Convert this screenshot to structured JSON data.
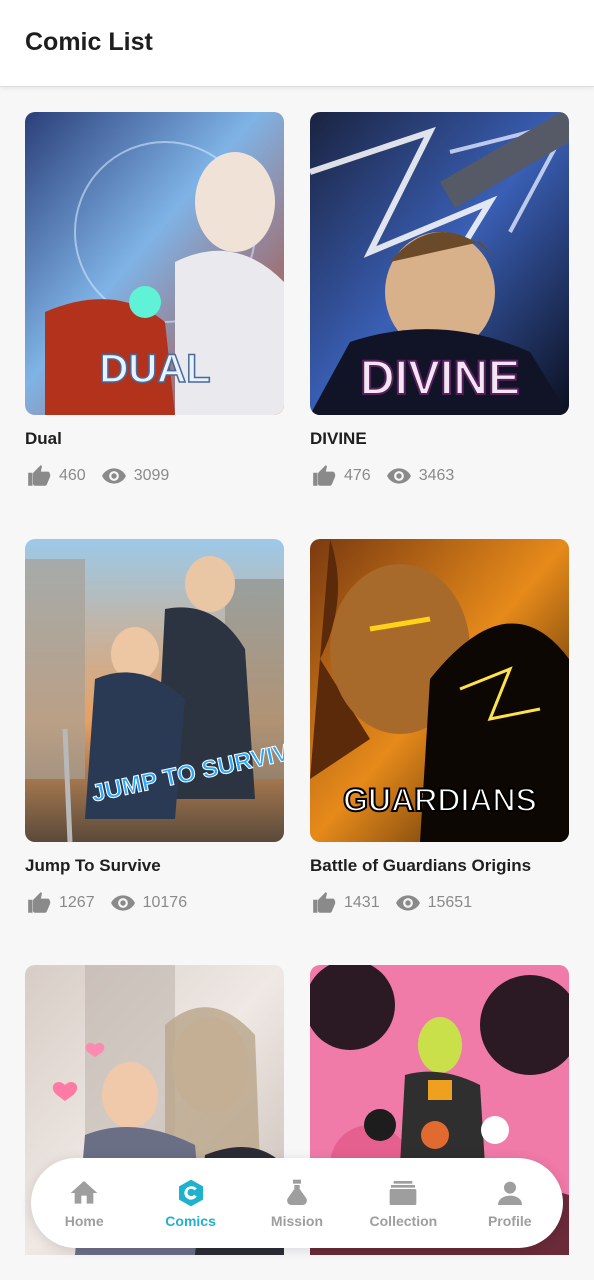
{
  "header": {
    "title": "Comic List"
  },
  "comics": [
    {
      "title": "Dual",
      "likes": "460",
      "views": "3099",
      "cover_text": "DUAL"
    },
    {
      "title": "DIVINE",
      "likes": "476",
      "views": "3463",
      "cover_text": "DIVINE"
    },
    {
      "title": "Jump To Survive",
      "likes": "1267",
      "views": "10176",
      "cover_text": "JUMP TO SURVIVE"
    },
    {
      "title": "Battle of Guardians Origins",
      "likes": "1431",
      "views": "15651",
      "cover_text": "GUARDIANS"
    },
    {
      "title": "",
      "likes": "",
      "views": "",
      "cover_text": ""
    },
    {
      "title": "",
      "likes": "",
      "views": "",
      "cover_text": ""
    }
  ],
  "nav": {
    "items": [
      {
        "label": "Home",
        "icon": "home-icon",
        "active": false
      },
      {
        "label": "Comics",
        "icon": "comics-icon",
        "active": true
      },
      {
        "label": "Mission",
        "icon": "mission-icon",
        "active": false
      },
      {
        "label": "Collection",
        "icon": "collection-icon",
        "active": false
      },
      {
        "label": "Profile",
        "icon": "profile-icon",
        "active": false
      }
    ]
  },
  "colors": {
    "accent": "#1fb2cf",
    "inactive": "#9e9e9e"
  }
}
